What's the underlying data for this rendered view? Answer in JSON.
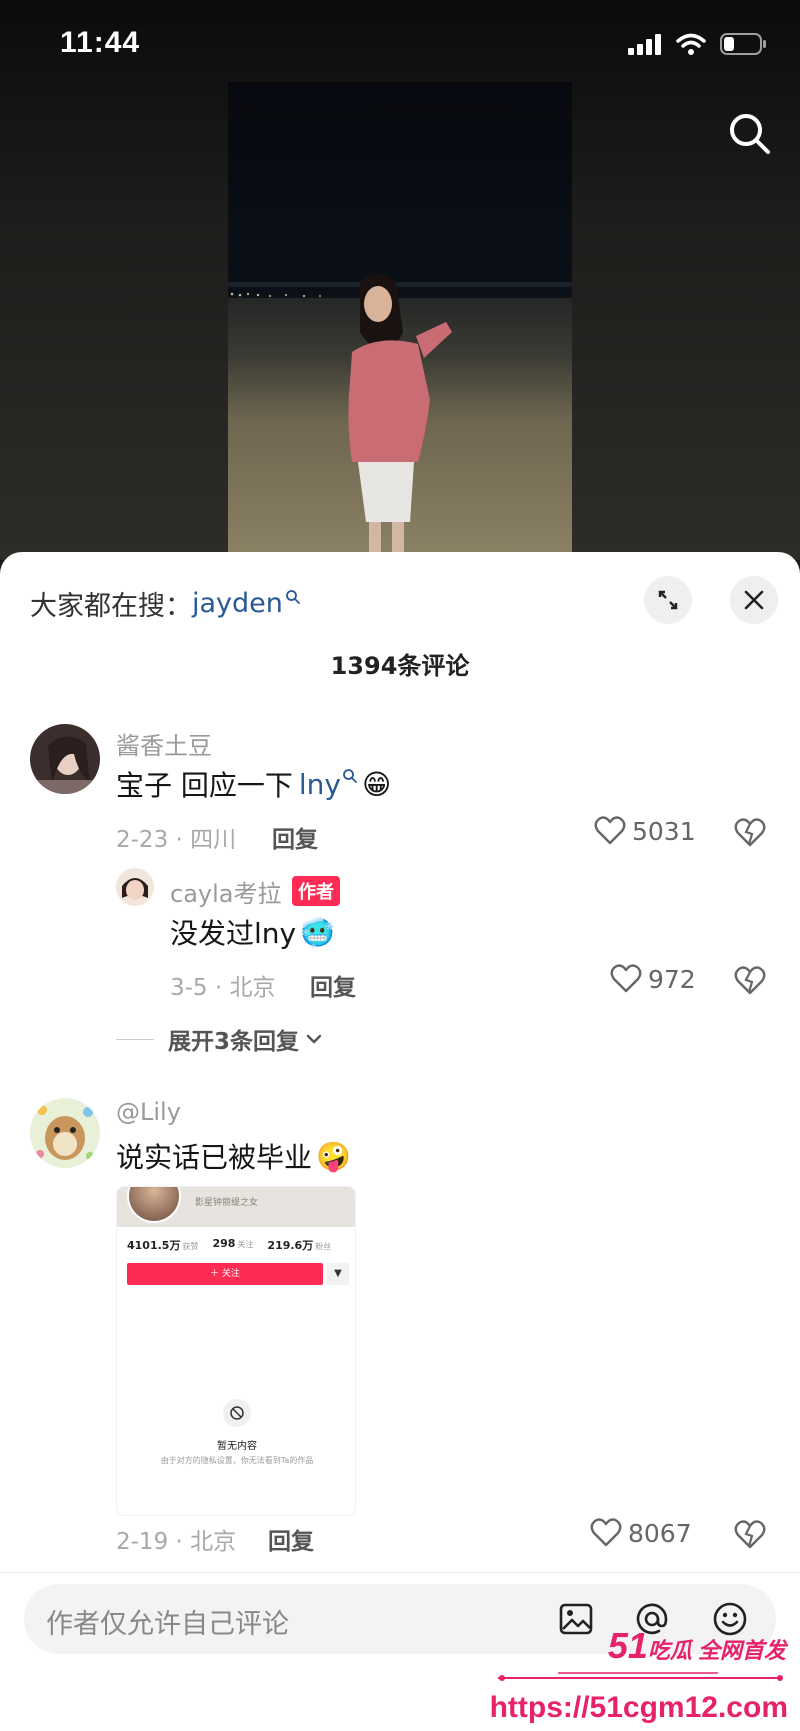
{
  "status_bar": {
    "time": "11:44"
  },
  "hot_search": {
    "prefix": "大家都在搜：",
    "keyword": "jayden"
  },
  "comment_count_title": "1394条评论",
  "comments": [
    {
      "username": "酱香土豆",
      "text": "宝子 回应一下",
      "link_text": "lny",
      "emoji": "😁",
      "date_location": "2-23 · 四川",
      "reply_label": "回复",
      "likes": "5031"
    },
    {
      "username": "@Lily",
      "text": "说实话已被毕业",
      "emoji": "🤪",
      "date_location": "2-19 · 北京",
      "reply_label": "回复",
      "likes": "8067",
      "attachment": {
        "header_tag": "影星钟丽缇之女",
        "stats": [
          {
            "value": "4101.5万",
            "label": "获赞"
          },
          {
            "value": "298",
            "label": "关注"
          },
          {
            "value": "219.6万",
            "label": "粉丝"
          }
        ],
        "follow_label": "＋ 关注",
        "empty_title": "暂无内容",
        "empty_desc": "由于对方的隐私设置，你无法看到Ta的作品"
      }
    }
  ],
  "reply": {
    "username": "cayla考拉",
    "badge": "作者",
    "text": "没发过lny",
    "emoji": "🥶",
    "date_location": "3-5 · 北京",
    "reply_label": "回复",
    "likes": "972"
  },
  "expand_replies": "展开3条回复",
  "input": {
    "placeholder": "作者仅允许自己评论"
  },
  "watermark": {
    "brand_num": "51",
    "brand_text": "吃瓜 全网首发",
    "url": "https://51cgm12.com"
  },
  "colors": {
    "accent": "#fe2c55",
    "link": "#2a5a96",
    "watermark": "#e6226a"
  }
}
